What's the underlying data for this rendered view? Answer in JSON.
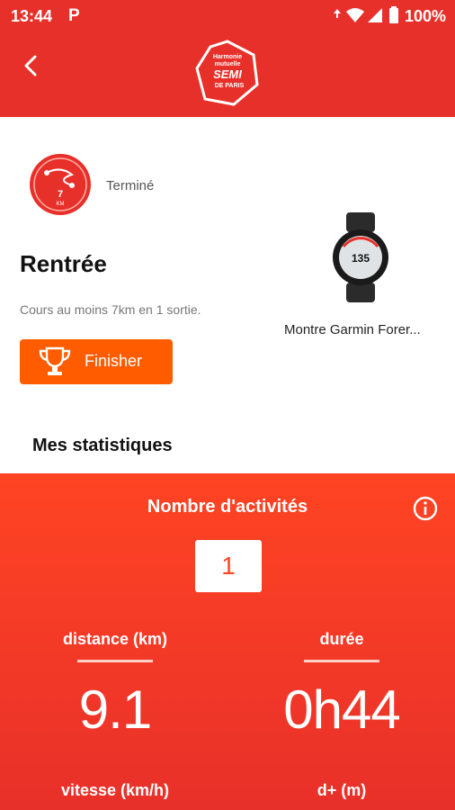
{
  "status_bar": {
    "time": "13:44",
    "app_letter": "P",
    "battery": "100%"
  },
  "header": {
    "logo_lines": [
      "Harmonie",
      "mutuelle",
      "SEMI",
      "DE PARIS"
    ]
  },
  "challenge": {
    "status": "Terminé",
    "badge_value": "7",
    "badge_unit": "KM",
    "title": "Rentrée",
    "description": "Cours au moins 7km en 1 sortie.",
    "finisher_label": "Finisher"
  },
  "reward": {
    "watch_name": "Montre Garmin Forer...",
    "watch_screen_value": "135"
  },
  "stats": {
    "heading": "Mes statistiques",
    "activities_label": "Nombre d'activités",
    "activities_count": "1",
    "distance_label": "distance (km)",
    "distance_value": "9.1",
    "duration_label": "durée",
    "duration_value": "0h44",
    "speed_label": "vitesse (km/h)",
    "elevation_label": "d+ (m)"
  },
  "colors": {
    "primary_red": "#e8302a",
    "orange_button": "#ff5c00",
    "panel_red": "#ff4423"
  }
}
